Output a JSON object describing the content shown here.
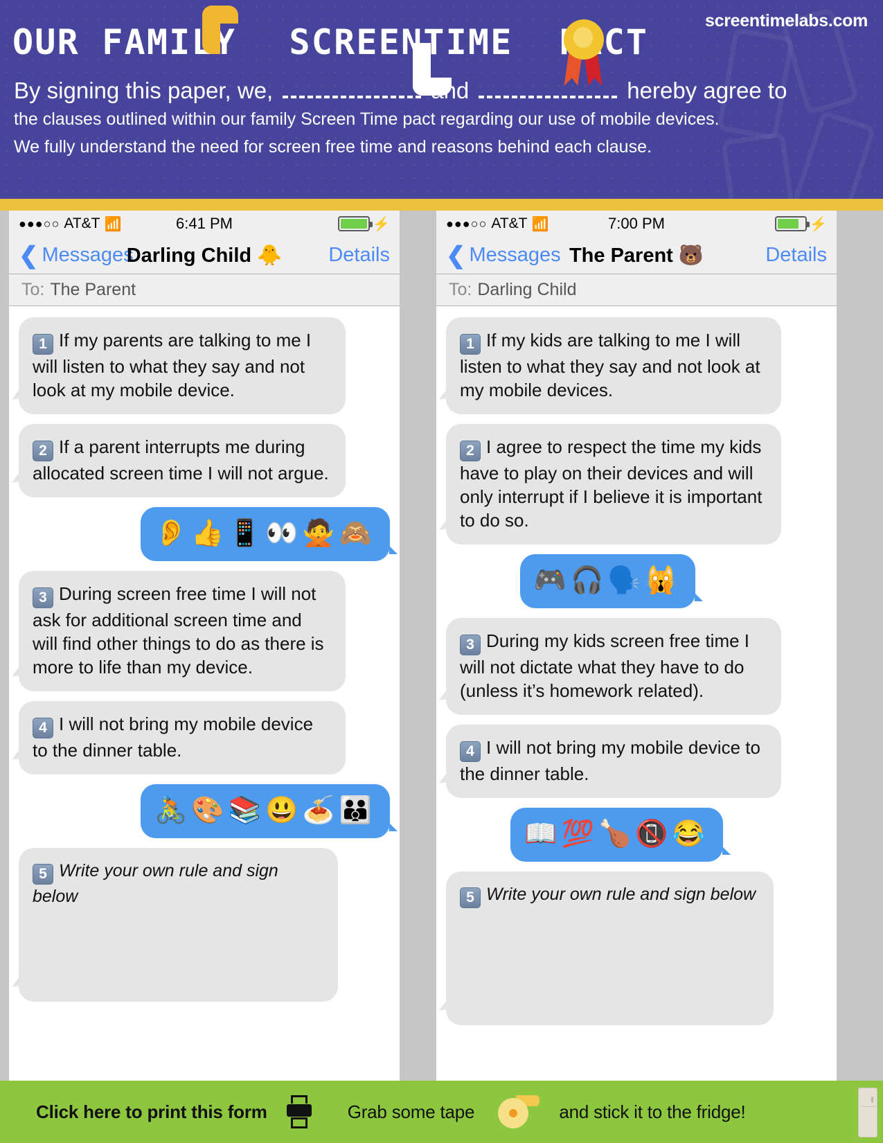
{
  "header": {
    "site_url": "screentimelabs.com",
    "title_part1": "OUR FAMILY",
    "title_part2": "SCREENTIME",
    "title_part3": "PACT",
    "intro_prefix": "By signing this paper, we,",
    "intro_and": "and",
    "intro_suffix": "hereby agree to",
    "intro_line2": "the clauses outlined within our family Screen Time pact regarding our use of mobile devices.",
    "intro_line3": "We fully understand the need for screen free time and reasons behind each clause.",
    "colors": {
      "purple": "#46459B",
      "gold": "#ECC23E",
      "quote_yellow": "#F2B631",
      "green": "#8DC63F"
    }
  },
  "phone_left": {
    "status": {
      "signal_dots": "●●●○○",
      "carrier": "AT&T",
      "wifi_icon": "wifi-icon",
      "time": "6:41 PM",
      "battery_level": "100",
      "charging_icon": "bolt-icon"
    },
    "nav": {
      "back_label": "Messages",
      "title": "Darling Child",
      "title_emoji": "🐥",
      "details_label": "Details"
    },
    "to_label": "To:",
    "to_name": "The Parent",
    "messages": [
      {
        "kind": "text",
        "side": "in",
        "number": "1",
        "text": "If my parents are talking to me I will listen to what they say and not look at my mobile device."
      },
      {
        "kind": "text",
        "side": "in",
        "number": "2",
        "text": "If a parent interrupts me during allocated screen time I will not argue."
      },
      {
        "kind": "emoji",
        "side": "out",
        "emojis": "👂👍📱👀🙅🙈",
        "names": "ear, thumbs-up, mobile-phone, eyes, person-gesturing-no, see-no-evil-monkey"
      },
      {
        "kind": "text",
        "side": "in",
        "number": "3",
        "text": "During screen free time I will not ask for additional screen time and will find other things to do as there is more to life than my device."
      },
      {
        "kind": "text",
        "side": "in",
        "number": "4",
        "text": "I will not bring my mobile device to the dinner table."
      },
      {
        "kind": "emoji",
        "side": "out",
        "emojis": "🚴🎨📚😃🍝👪",
        "names": "cyclist, artist-palette, books, grinning-face, spaghetti, family"
      },
      {
        "kind": "writein",
        "side": "in",
        "number": "5",
        "text": "Write your own rule and sign below"
      }
    ]
  },
  "phone_right": {
    "status": {
      "signal_dots": "●●●○○",
      "carrier": "AT&T",
      "wifi_icon": "wifi-icon",
      "time": "7:00 PM",
      "battery_level": "80",
      "charging_icon": "bolt-icon"
    },
    "nav": {
      "back_label": "Messages",
      "title": "The Parent",
      "title_emoji": "🐻",
      "details_label": "Details"
    },
    "to_label": "To:",
    "to_name": "Darling Child",
    "messages": [
      {
        "kind": "text",
        "side": "in",
        "number": "1",
        "text": "If my kids are talking to me I will listen to what they say and not look at my mobile devices."
      },
      {
        "kind": "text",
        "side": "in",
        "number": "2",
        "text": "I agree to respect the time my kids have to play on their devices and will only interrupt if I believe it is important to do so."
      },
      {
        "kind": "emoji",
        "side": "out",
        "emojis": "🎮🎧🗣️🙀",
        "names": "video-game, headphone-music, speaking-head, weary-cat"
      },
      {
        "kind": "text",
        "side": "in",
        "number": "3",
        "text": "During my kids screen free time I will not dictate what they have to do (unless it’s homework related)."
      },
      {
        "kind": "text",
        "side": "in",
        "number": "4",
        "text": "I will not bring my mobile device to the dinner table."
      },
      {
        "kind": "emoji",
        "side": "out",
        "emojis": "📖💯🍗📵😂",
        "names": "open-book, hundred-points, poultry-leg, no-mobile-phones, face-with-tears-of-joy"
      },
      {
        "kind": "writein",
        "side": "in",
        "number": "5",
        "text": "Write your own rule and sign below"
      }
    ]
  },
  "footer": {
    "print_label": "Click here to print this form",
    "printer_icon": "printer-icon",
    "tape_label": "Grab some tape",
    "tape_icon": "tape-roll-icon",
    "fridge_label": "and stick it to the fridge!",
    "fridge_icon": "fridge-icon"
  }
}
